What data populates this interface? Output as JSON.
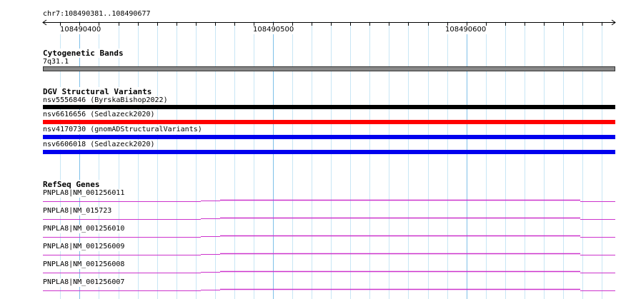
{
  "location": "chr7:108490381..108490677",
  "ruler": {
    "start": 108490381,
    "end": 108490677,
    "labels": [
      "108490400",
      "108490500",
      "108490600"
    ]
  },
  "tracks": {
    "cytoband": {
      "title": "Cytogenetic Bands",
      "band": "7q31.1",
      "color": "#888888"
    },
    "dgv": {
      "title": "DGV Structural Variants",
      "items": [
        {
          "label": "nsv5556846 (ByrskaBishop2022)",
          "color": "#000000"
        },
        {
          "label": "nsv6616656 (Sedlazeck2020)",
          "color": "#ff0000"
        },
        {
          "label": "nsv4170730 (gnomADStructuralVariants)",
          "color": "#0000ee"
        },
        {
          "label": "nsv6606018 (Sedlazeck2020)",
          "color": "#0000ee"
        }
      ]
    },
    "refseq": {
      "title": "RefSeq Genes",
      "color": "#cc33cc",
      "items": [
        {
          "label": "PNPLA8|NM_001256011"
        },
        {
          "label": "PNPLA8|NM_015723"
        },
        {
          "label": "PNPLA8|NM_001256010"
        },
        {
          "label": "PNPLA8|NM_001256009"
        },
        {
          "label": "PNPLA8|NM_001256008"
        },
        {
          "label": "PNPLA8|NM_001256007"
        }
      ]
    }
  },
  "colors": {
    "grid_minor": "#c8e6f5",
    "grid_major": "#7ec0e8",
    "background": "#ffffff"
  }
}
